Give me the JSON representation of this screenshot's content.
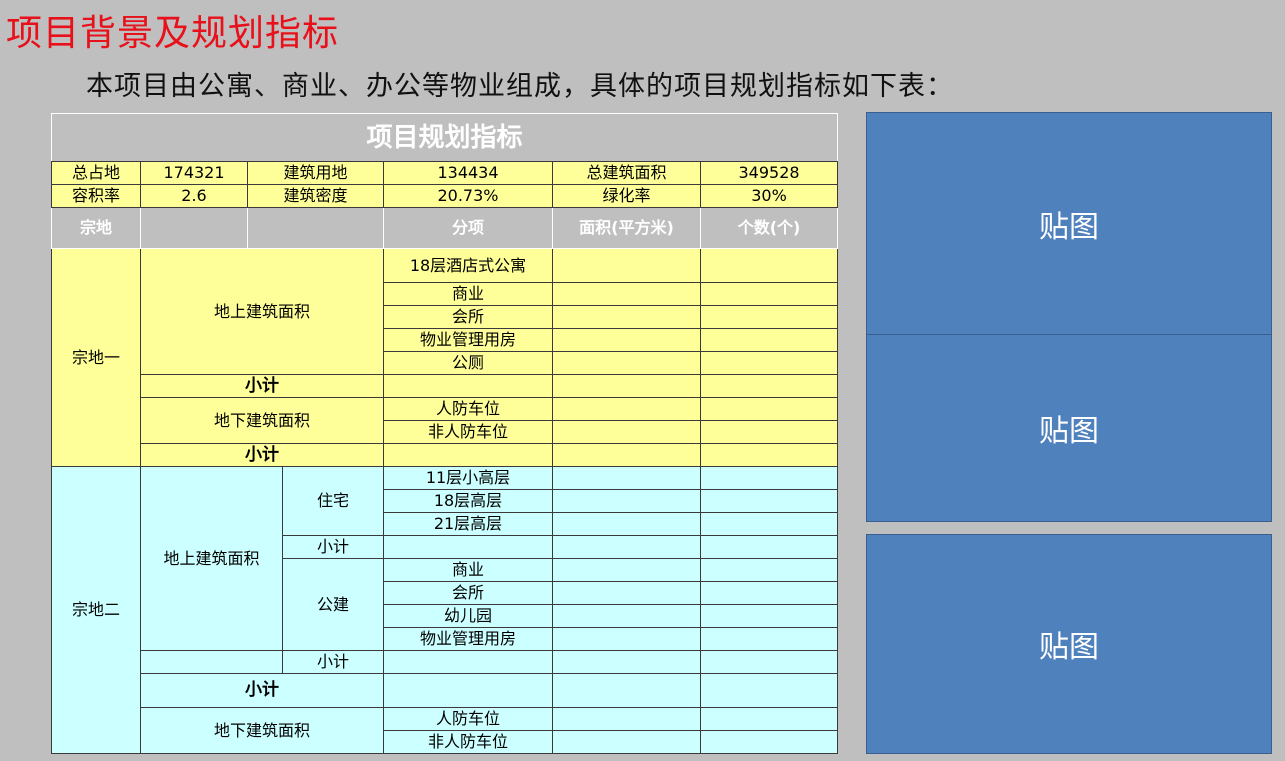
{
  "title": "项目背景及规划指标",
  "subtitle": "本项目由公寓、商业、办公等物业组成，具体的项目规划指标如下表：",
  "table": {
    "title": "项目规划指标",
    "stats": {
      "r1": [
        "总占地",
        "174321",
        "建筑用地",
        "134434",
        "总建筑面积",
        "349528"
      ],
      "r2": [
        "容积率",
        "2.6",
        "建筑密度",
        "20.73%",
        "绿化率",
        "30%"
      ]
    },
    "header": {
      "zongdi": "宗地",
      "fenxiang": "分项",
      "mianji": "面积(平方米)",
      "geshu": "个数(个)"
    },
    "parcel1": {
      "name": "宗地一",
      "above": "地上建筑面积",
      "above_items": [
        "18层酒店式公寓",
        "商业",
        "会所",
        "物业管理用房",
        "公厕"
      ],
      "subtotal": "小计",
      "below": "地下建筑面积",
      "below_items": [
        "人防车位",
        "非人防车位"
      ]
    },
    "parcel2": {
      "name": "宗地二",
      "above": "地上建筑面积",
      "residential": "住宅",
      "residential_items": [
        "11层小高层",
        "18层高层",
        "21层高层"
      ],
      "public": "公建",
      "public_items": [
        "商业",
        "会所",
        "幼儿园",
        "物业管理用房"
      ],
      "subtotal": "小计",
      "below": "地下建筑面积",
      "below_items": [
        "人防车位",
        "非人防车位"
      ]
    }
  },
  "panels": [
    "贴图",
    "贴图",
    "贴图"
  ],
  "colors": {
    "title": "#e8101a",
    "parcel1_fill": "#ffff99",
    "parcel2_fill": "#ccffff",
    "panel_fill": "#4f81bd"
  }
}
